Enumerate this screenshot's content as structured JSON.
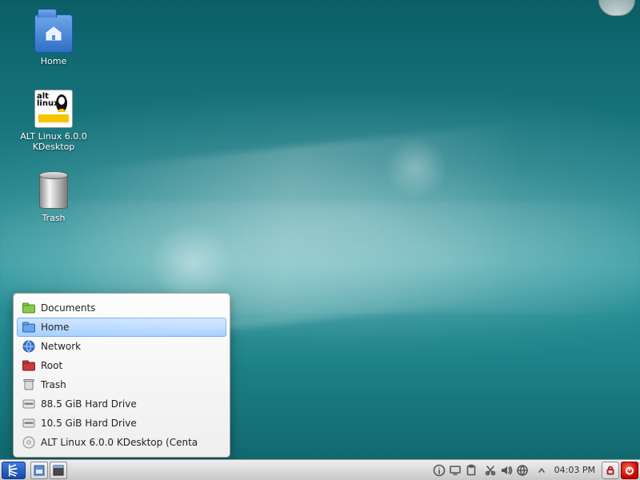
{
  "desktop_icons": {
    "home": {
      "label": "Home"
    },
    "alt": {
      "label": "ALT Linux 6.0.0 KDesktop"
    },
    "trash": {
      "label": "Trash"
    }
  },
  "places_popup": {
    "items": [
      {
        "label": "Documents",
        "icon": "folder-green",
        "selected": false
      },
      {
        "label": "Home",
        "icon": "folder-blue",
        "selected": true
      },
      {
        "label": "Network",
        "icon": "network",
        "selected": false
      },
      {
        "label": "Root",
        "icon": "folder-red",
        "selected": false
      },
      {
        "label": "Trash",
        "icon": "trash",
        "selected": false
      },
      {
        "label": "88.5 GiB Hard Drive",
        "icon": "drive",
        "selected": false
      },
      {
        "label": "10.5 GiB Hard Drive",
        "icon": "drive",
        "selected": false
      },
      {
        "label": "ALT Linux 6.0.0 KDesktop  (Centa",
        "icon": "cd",
        "selected": false
      }
    ]
  },
  "taskbar": {
    "clock": "04:03 PM"
  },
  "altlinux_logo": {
    "top": "alt",
    "bottom": "linux"
  }
}
